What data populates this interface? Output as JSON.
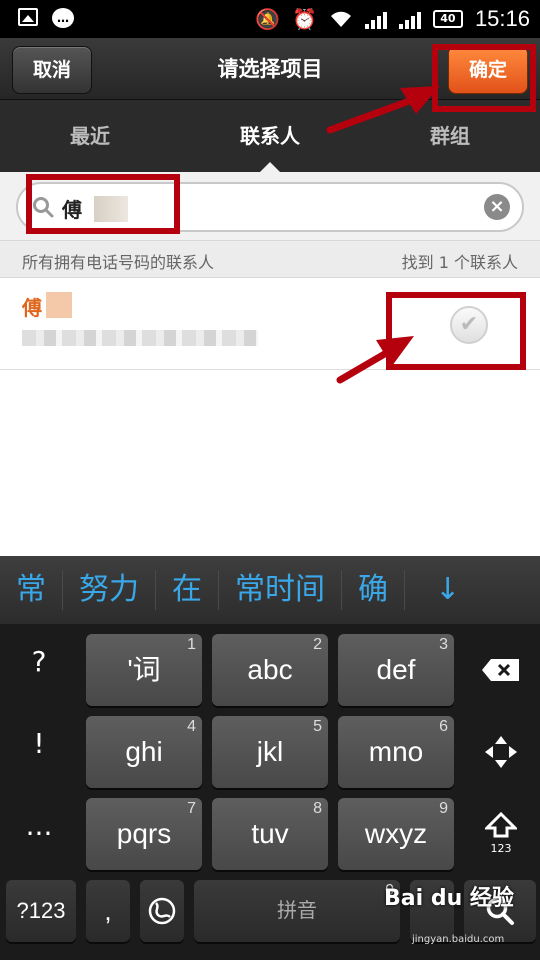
{
  "status_bar": {
    "time": "15:16",
    "battery": "40",
    "icons": [
      "image-icon",
      "chat-icon",
      "mute-icon",
      "alarm-icon",
      "wifi-icon",
      "signal-icon",
      "battery-icon"
    ]
  },
  "header": {
    "cancel_label": "取消",
    "title": "请选择项目",
    "confirm_label": "确定"
  },
  "tabs": [
    {
      "label": "最近",
      "active": false
    },
    {
      "label": "联系人",
      "active": true
    },
    {
      "label": "群组",
      "active": false
    }
  ],
  "search": {
    "value": "傅"
  },
  "info": {
    "left": "所有拥有电话号码的联系人",
    "right": "找到 1 个联系人"
  },
  "contacts": [
    {
      "name": "傅",
      "checked": false
    }
  ],
  "ime": {
    "candidates": [
      "常",
      "努力",
      "在",
      "常时间",
      "确"
    ],
    "symbols": [
      "?",
      "!",
      "...",
      "~"
    ],
    "keys": [
      {
        "label": "'词",
        "num": "1"
      },
      {
        "label": "abc",
        "num": "2"
      },
      {
        "label": "def",
        "num": "3"
      },
      {
        "label": "ghi",
        "num": "4"
      },
      {
        "label": "jkl",
        "num": "5"
      },
      {
        "label": "mno",
        "num": "6"
      },
      {
        "label": "pqrs",
        "num": "7"
      },
      {
        "label": "tuv",
        "num": "8"
      },
      {
        "label": "wxyz",
        "num": "9"
      }
    ],
    "bottom": {
      "sym_label": "?123",
      "comma": ",",
      "space_label": "拼音",
      "space_num": "0",
      "shift_sub": "123"
    }
  },
  "watermark": {
    "text": "Bai du 经验",
    "sub": "jingyan.baidu.com"
  },
  "colors": {
    "accent_orange": "#e2521a",
    "annotation_red": "#b5000d",
    "candidate_blue": "#3aa8e8"
  }
}
